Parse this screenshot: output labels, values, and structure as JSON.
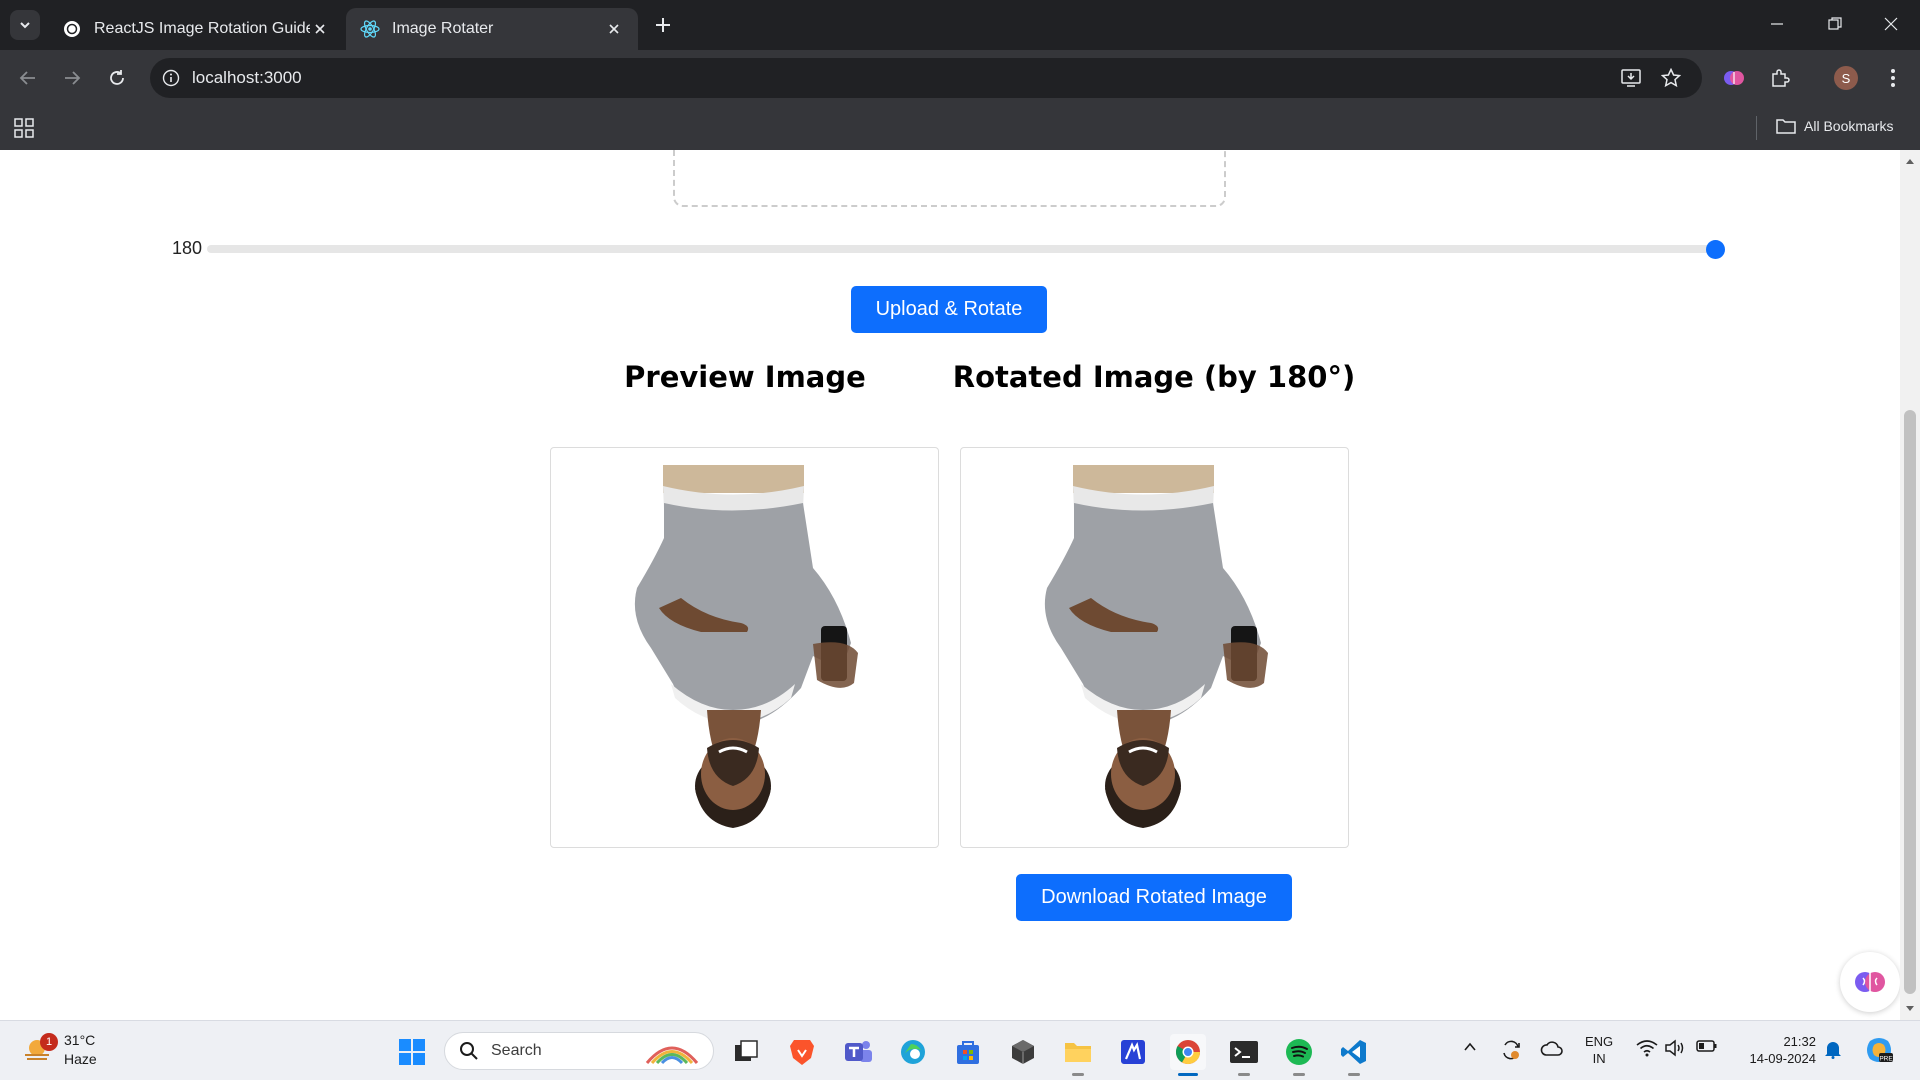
{
  "browser": {
    "tabs": [
      {
        "title": "ReactJS Image Rotation Guide",
        "favicon": "chatgpt-icon",
        "active": false
      },
      {
        "title": "Image Rotater",
        "favicon": "react-icon",
        "active": true
      }
    ],
    "url": "localhost:3000",
    "profile_initial": "S",
    "bookmarks_label": "All Bookmarks"
  },
  "page": {
    "rotation_value": "180",
    "rotation_fraction": 1.0,
    "upload_button_label": "Upload & Rotate",
    "preview_heading": "Preview Image",
    "rotated_heading": "Rotated Image (by 180°)",
    "download_button_label": "Download Rotated Image",
    "accent_color": "#0d6efd"
  },
  "taskbar": {
    "weather_temp": "31°C",
    "weather_desc": "Haze",
    "weather_badge": "1",
    "search_label": "Search",
    "lang_line1": "ENG",
    "lang_line2": "IN",
    "time": "21:32",
    "date": "14-09-2024",
    "pinned_apps": [
      "start-icon",
      "search-icon",
      "task-view-icon",
      "brave-icon",
      "teams-icon",
      "edge-icon",
      "store-icon",
      "app-icon",
      "file-explorer-icon",
      "app-icon",
      "chrome-icon",
      "terminal-icon",
      "spotify-icon",
      "vscode-icon"
    ]
  }
}
